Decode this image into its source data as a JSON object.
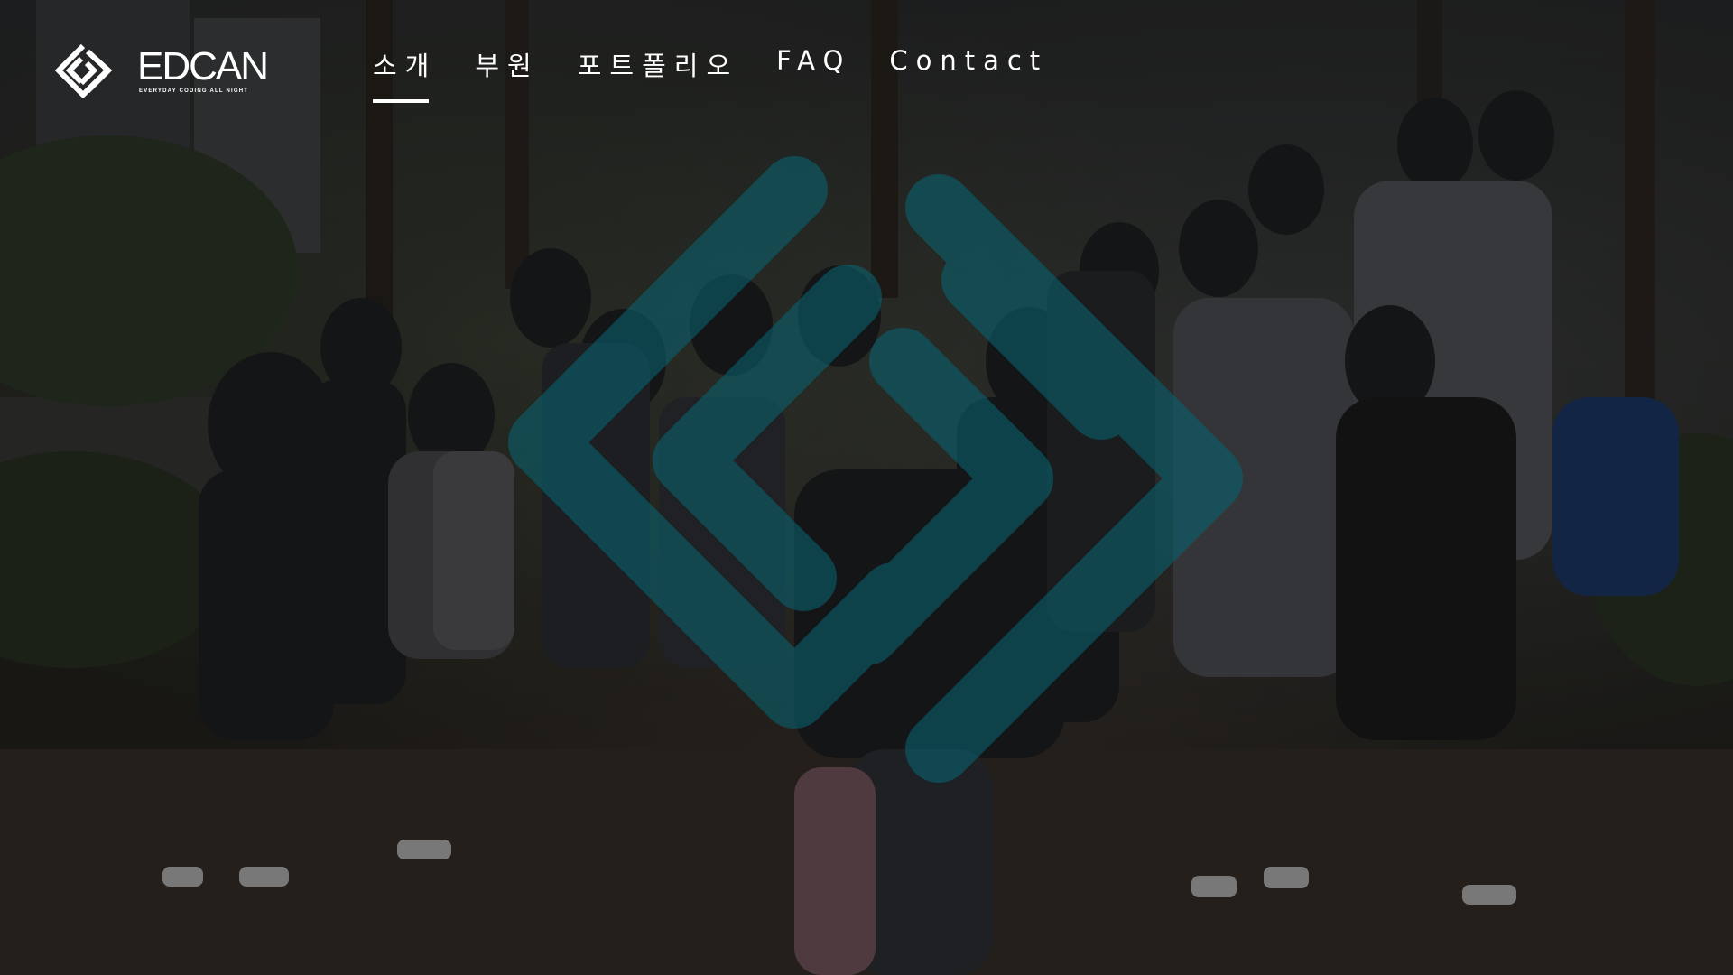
{
  "brand": {
    "name": "EDCAN",
    "tagline": "EVERYDAY CODING ALL NIGHT",
    "accent_color": "#ffffff"
  },
  "nav": {
    "items": [
      {
        "label": "소개",
        "active": true
      },
      {
        "label": "부원",
        "active": false
      },
      {
        "label": "포트폴리오",
        "active": false
      },
      {
        "label": "FAQ",
        "active": false
      },
      {
        "label": "Contact",
        "active": false
      }
    ]
  },
  "hero": {
    "background": "group-photo",
    "watermark_icon": "edcan-diamond-logo-icon",
    "watermark_color": "#0a5f6c"
  }
}
